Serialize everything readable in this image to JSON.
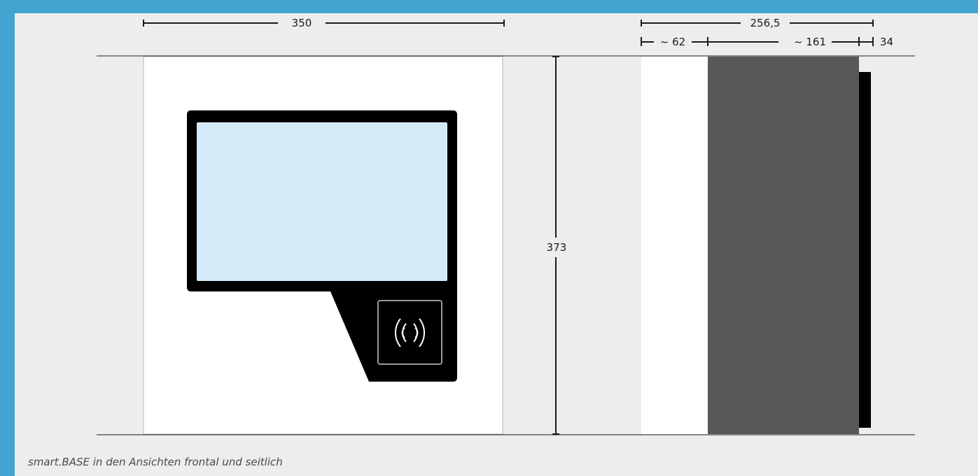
{
  "dimensions": {
    "front_width": "350",
    "height": "373",
    "side_total": "256,5",
    "side_front": "~ 62",
    "side_body": "~ 161",
    "side_back": "34"
  },
  "caption": "smart.BASE in den Ansichten frontal und seitlich",
  "icons": {
    "nfc": "nfc-contactless-icon"
  },
  "colors": {
    "frame": "#43a4d0",
    "panel": "#eceeed",
    "housing_front": "#ffffff",
    "device_bezel": "#000000",
    "screen": "#d4eaf8",
    "side_body": "#58585a",
    "side_back": "#000000",
    "nfc_outline": "#9a9a9a"
  }
}
